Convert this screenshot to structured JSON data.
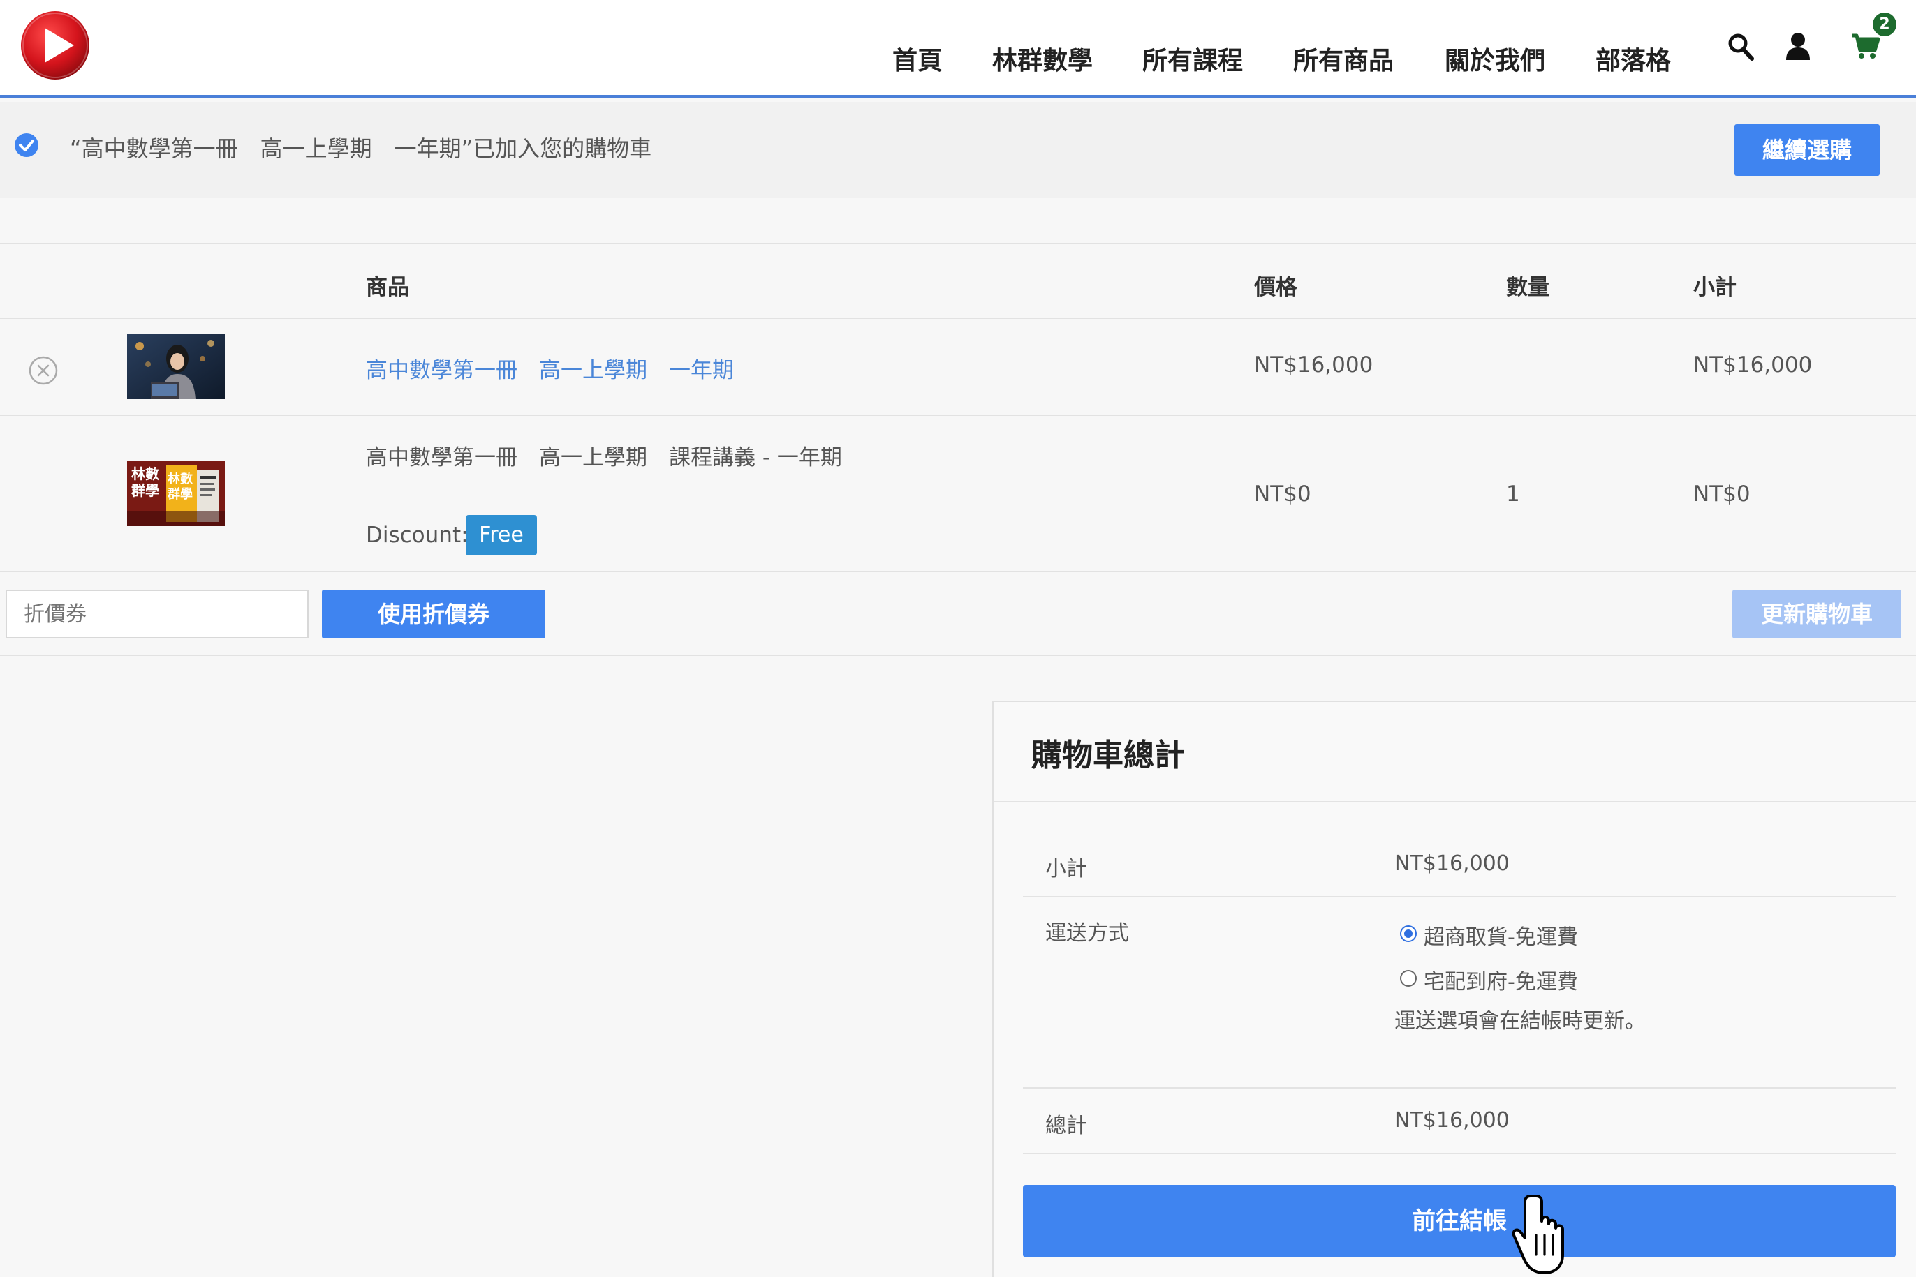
{
  "header": {
    "nav": [
      "首頁",
      "林群數學",
      "所有課程",
      "所有商品",
      "關於我們",
      "部落格"
    ],
    "cart_count": "2",
    "icons": [
      "play-logo-icon",
      "search-icon",
      "user-icon",
      "cart-icon"
    ]
  },
  "notice": {
    "message": "“高中數學第一冊　高一上學期　一年期”已加入您的購物車",
    "continue_label": "繼續選購"
  },
  "cart_table": {
    "headers": {
      "product": "商品",
      "price": "價格",
      "quantity": "數量",
      "subtotal": "小計"
    },
    "rows": [
      {
        "name": "高中數學第一冊　高一上學期　一年期",
        "price": "NT$16,000",
        "quantity": "",
        "subtotal": "NT$16,000"
      },
      {
        "name": "高中數學第一冊　高一上學期　課程講義 - 一年期",
        "price": "NT$0",
        "quantity": "1",
        "subtotal": "NT$0",
        "discount_label": "Discount:",
        "discount_badge": "Free"
      }
    ],
    "thumb_text": {
      "a": "林數",
      "b": "群學",
      "c": "林數",
      "d": "群學"
    }
  },
  "coupon": {
    "placeholder": "折價券",
    "apply_label": "使用折價券",
    "update_label": "更新購物車"
  },
  "totals": {
    "title": "購物車總計",
    "subtotal_label": "小計",
    "subtotal_value": "NT$16,000",
    "shipping_label": "運送方式",
    "shipping_options": [
      "超商取貨-免運費",
      "宅配到府-免運費"
    ],
    "shipping_selected": 0,
    "shipping_note": "運送選項會在結帳時更新。",
    "total_label": "總計",
    "total_value": "NT$16,000",
    "checkout_label": "前往結帳"
  },
  "colors": {
    "accent": "#3f84f0",
    "header_line": "#4a7fd8",
    "free_badge": "#2e90d2",
    "cart_badge": "#1d6b2e",
    "link": "#4a86d8",
    "logo_red": "#d4141c"
  }
}
